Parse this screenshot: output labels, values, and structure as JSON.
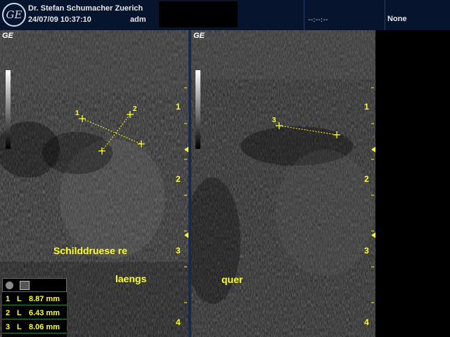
{
  "header": {
    "clinic": "Dr. Stefan Schumacher Zuerich",
    "datetime": "24/07/09 10:37:10",
    "user": "adm",
    "timer": "--:--:--",
    "preset": "None"
  },
  "panes": {
    "left": {
      "badge": "GE",
      "annotation_line1": "Schilddruese re",
      "annotation_line2": "laengs"
    },
    "right": {
      "badge": "GE",
      "annotation": "quer"
    }
  },
  "depth_marks": [
    "1",
    "2",
    "3",
    "4"
  ],
  "measure_labels": [
    "1",
    "2",
    "3"
  ],
  "measurements": [
    {
      "index": "1",
      "type": "L",
      "value": "8.87 mm"
    },
    {
      "index": "2",
      "type": "L",
      "value": "6.43 mm"
    },
    {
      "index": "3",
      "type": "L",
      "value": "8.06 mm"
    }
  ],
  "colors": {
    "annotation": "#ffff20",
    "header_bg": "#06142e",
    "row_divider": "#1e8a3a"
  },
  "icons": [
    "ge-logo",
    "record-icon",
    "report-icon"
  ]
}
